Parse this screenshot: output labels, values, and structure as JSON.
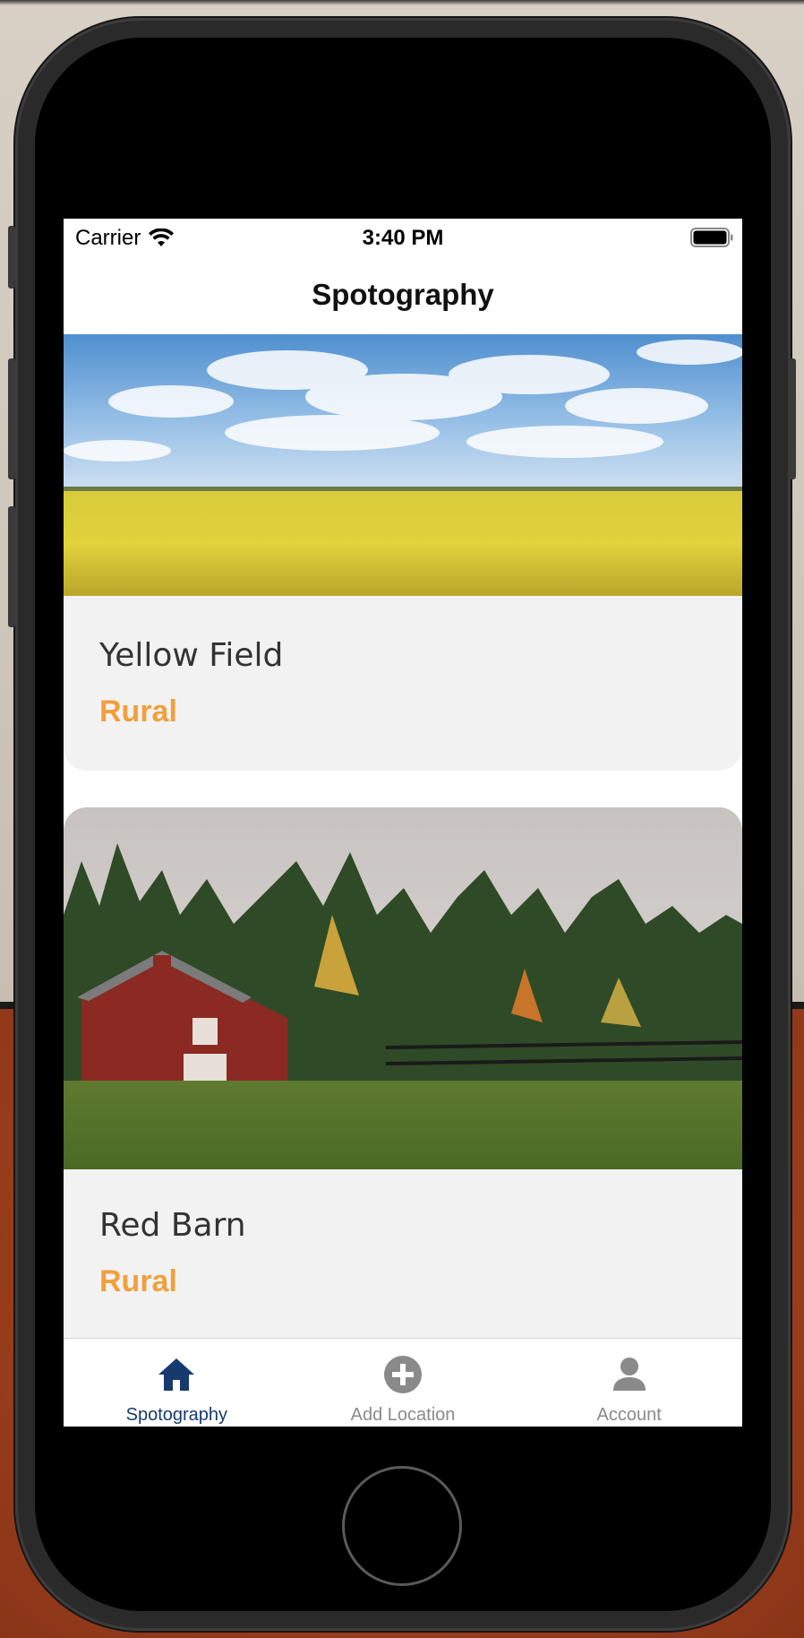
{
  "status_bar": {
    "carrier": "Carrier",
    "time": "3:40 PM"
  },
  "nav": {
    "title": "Spotography"
  },
  "cards": [
    {
      "title": "Yellow Field",
      "tag": "Rural"
    },
    {
      "title": "Red Barn",
      "tag": "Rural"
    }
  ],
  "tabs": [
    {
      "label": "Spotography",
      "icon": "home-icon",
      "active": true
    },
    {
      "label": "Add Location",
      "icon": "plus-circle-icon",
      "active": false
    },
    {
      "label": "Account",
      "icon": "person-icon",
      "active": false
    }
  ],
  "colors": {
    "accent": "#f0a03c",
    "active_tab": "#173a6e",
    "inactive_tab": "#8a8a8a",
    "card_bg": "#f3f2f3"
  }
}
